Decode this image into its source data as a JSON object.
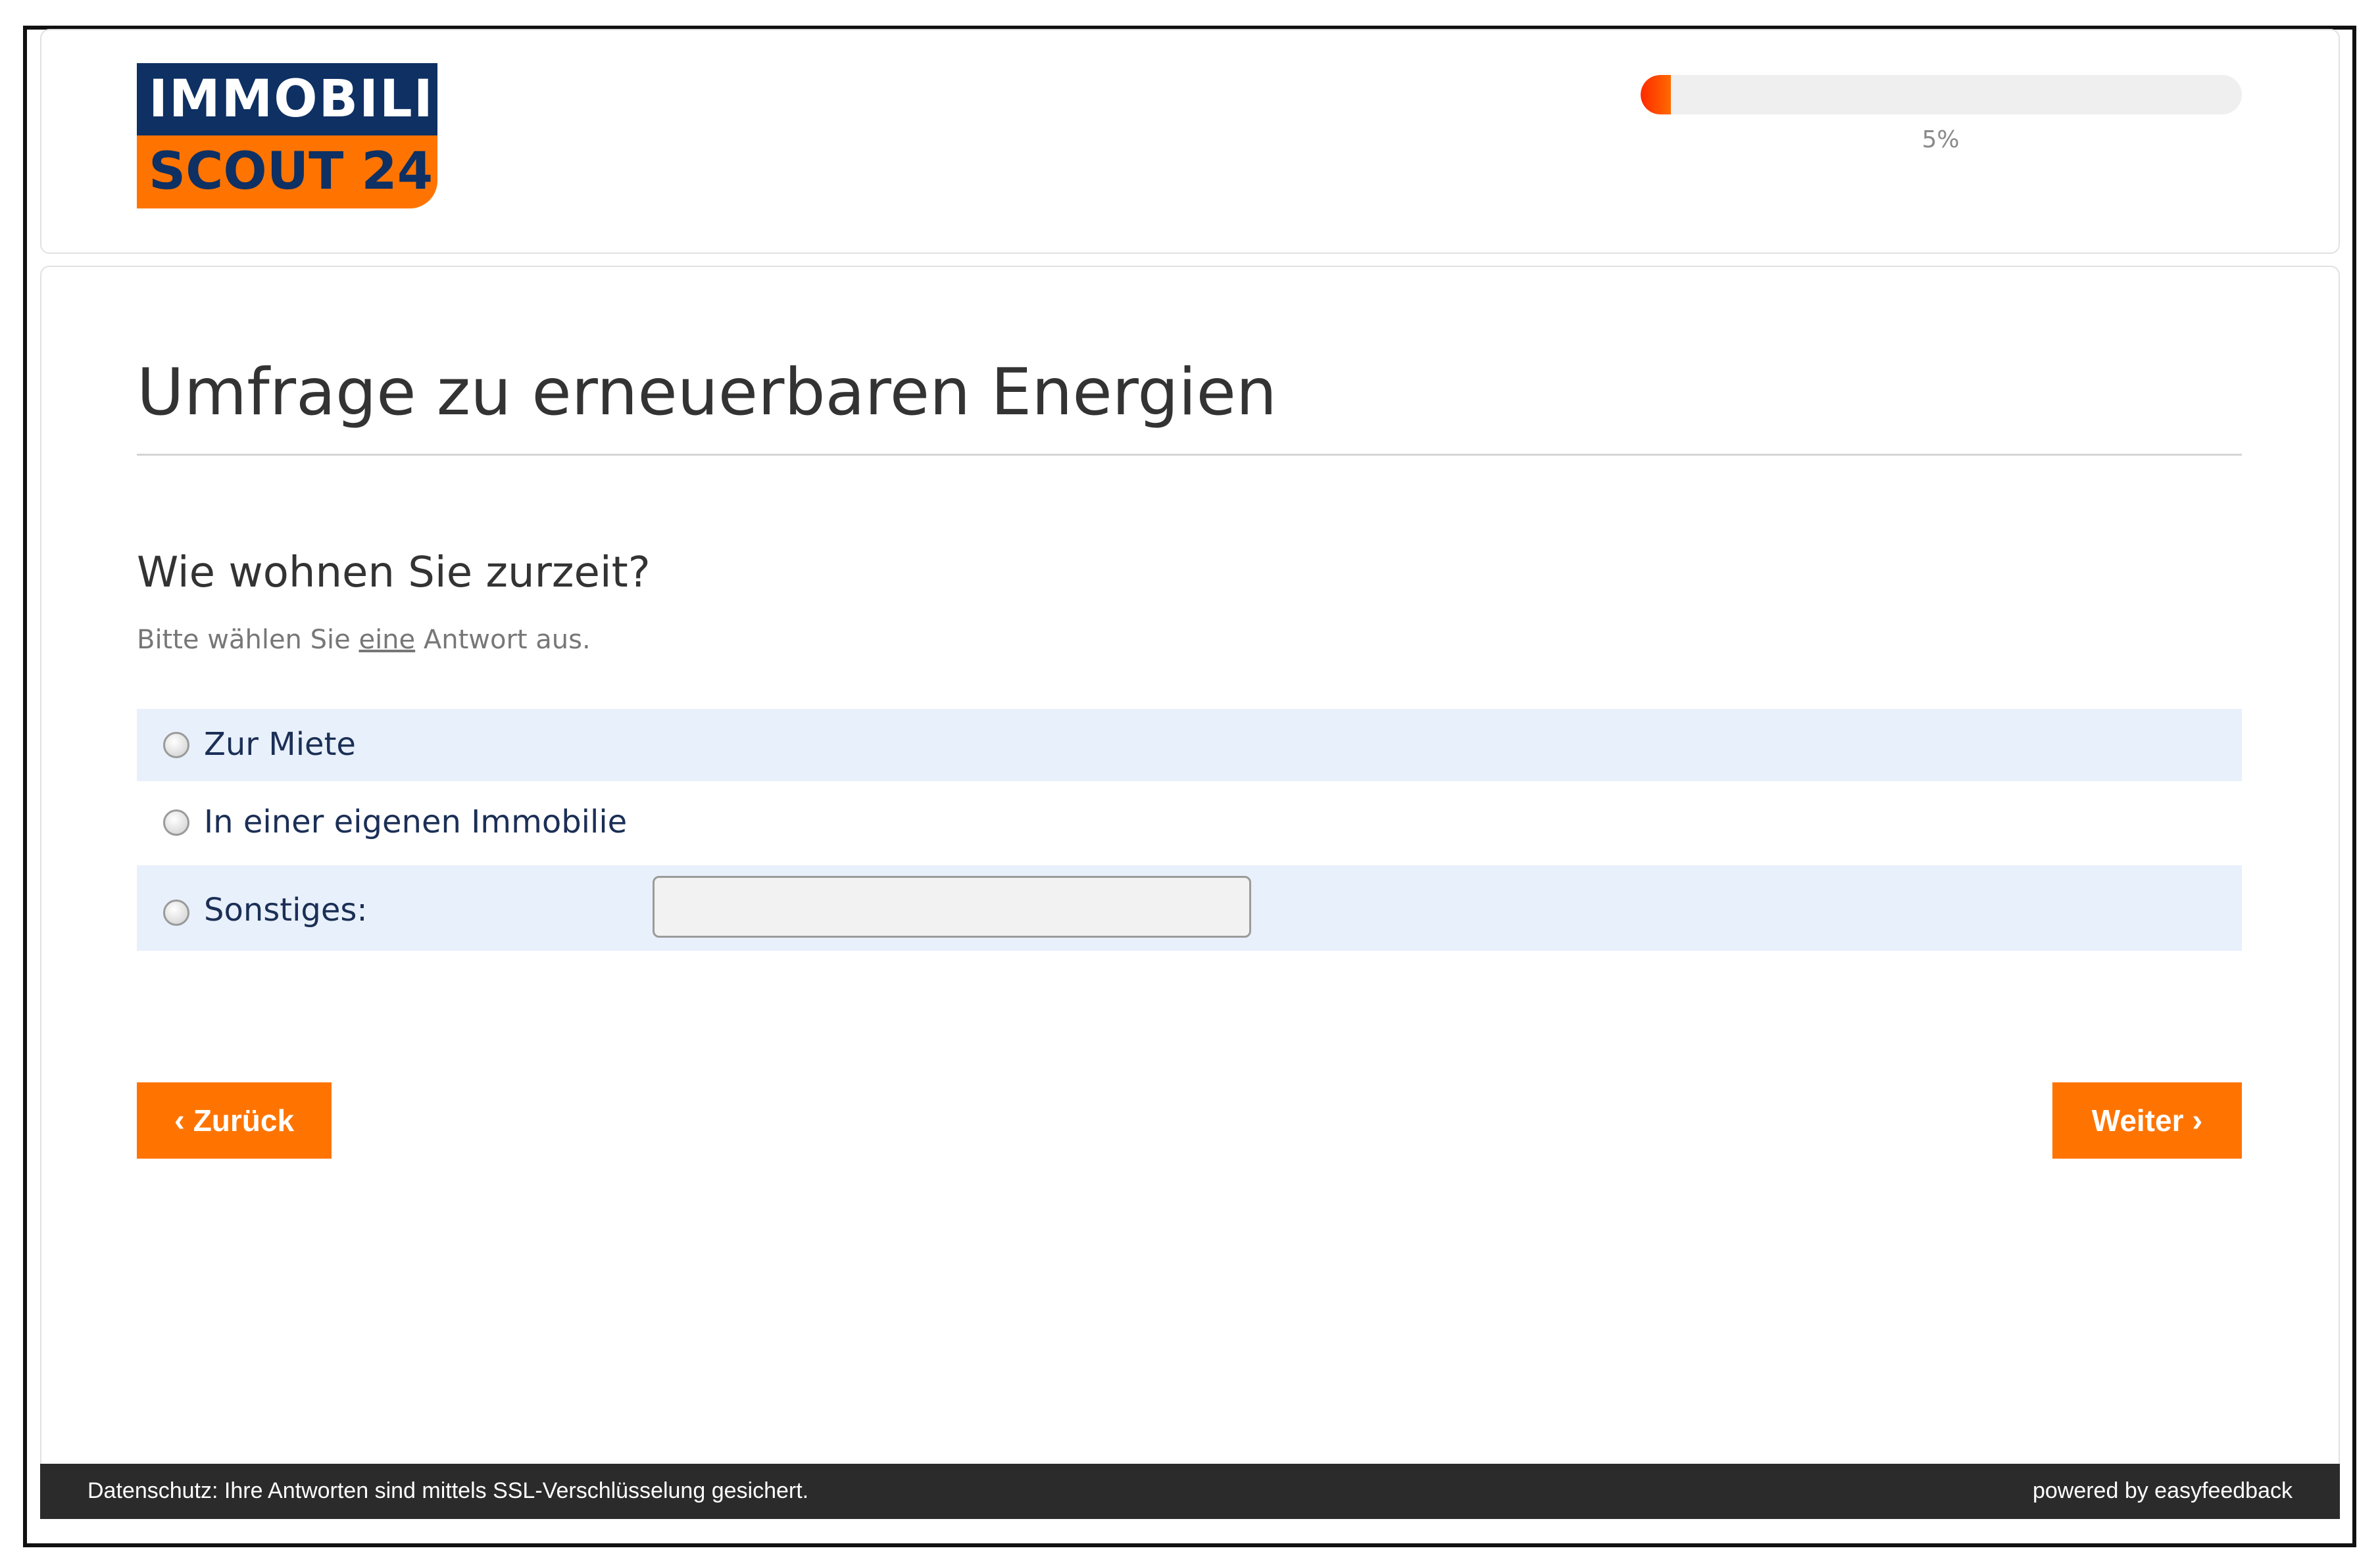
{
  "brand": {
    "line1": "IMMOBILIEN",
    "line2": "SCOUT 24",
    "colors": {
      "navy": "#0e3063",
      "orange": "#ff7400"
    }
  },
  "progress": {
    "percent": 5,
    "label": "5%"
  },
  "survey": {
    "title": "Umfrage zu erneuerbaren Energien"
  },
  "question": {
    "text": "Wie wohnen Sie zurzeit?",
    "hint_before": "Bitte wählen Sie ",
    "hint_emphasis": "eine",
    "hint_after": " Antwort aus.",
    "options": [
      {
        "label": "Zur Miete",
        "selected": false
      },
      {
        "label": "In einer eigenen Immobilie",
        "selected": false
      },
      {
        "label": "Sonstiges:",
        "selected": false
      }
    ],
    "other_input": {
      "value": "",
      "placeholder": ""
    }
  },
  "nav": {
    "back_label": "Zurück",
    "next_label": "Weiter",
    "back_icon": "chevron-left-icon",
    "next_icon": "chevron-right-icon"
  },
  "footer": {
    "privacy_text": "Datenschutz: Ihre Antworten sind mittels SSL-Verschlüsselung gesichert.",
    "powered_by": "powered by easyfeedback"
  }
}
